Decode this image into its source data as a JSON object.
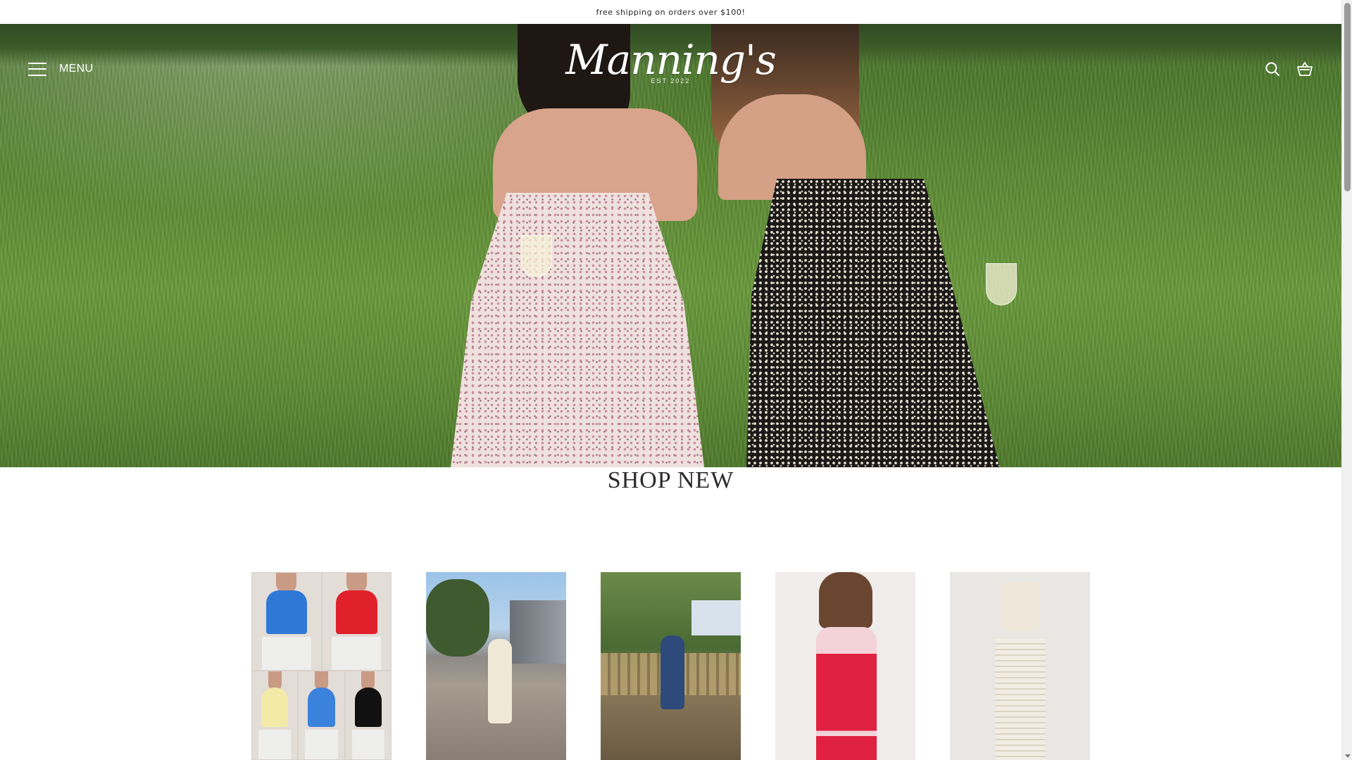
{
  "announcement": {
    "text": "free shipping on orders over $100!"
  },
  "header": {
    "menu_label": "MENU",
    "logo_text": "Manning's",
    "logo_subtext": "EST 2022",
    "icons": [
      "search-icon",
      "cart-icon",
      "hamburger-icon"
    ]
  },
  "hero": {
    "image_icon": "hero-photo"
  },
  "shop_new": {
    "title": "SHOP NEW",
    "products": [
      {
        "image_icon": "product-image-tank-tops"
      },
      {
        "image_icon": "product-image-floral-romper"
      },
      {
        "image_icon": "product-image-navy-romper"
      },
      {
        "image_icon": "product-image-red-halter-dress"
      },
      {
        "image_icon": "product-image-cream-two-piece"
      }
    ]
  },
  "colors": {
    "header_text": "#ffffff",
    "title_text": "#2b2b2b",
    "background": "#ffffff"
  }
}
